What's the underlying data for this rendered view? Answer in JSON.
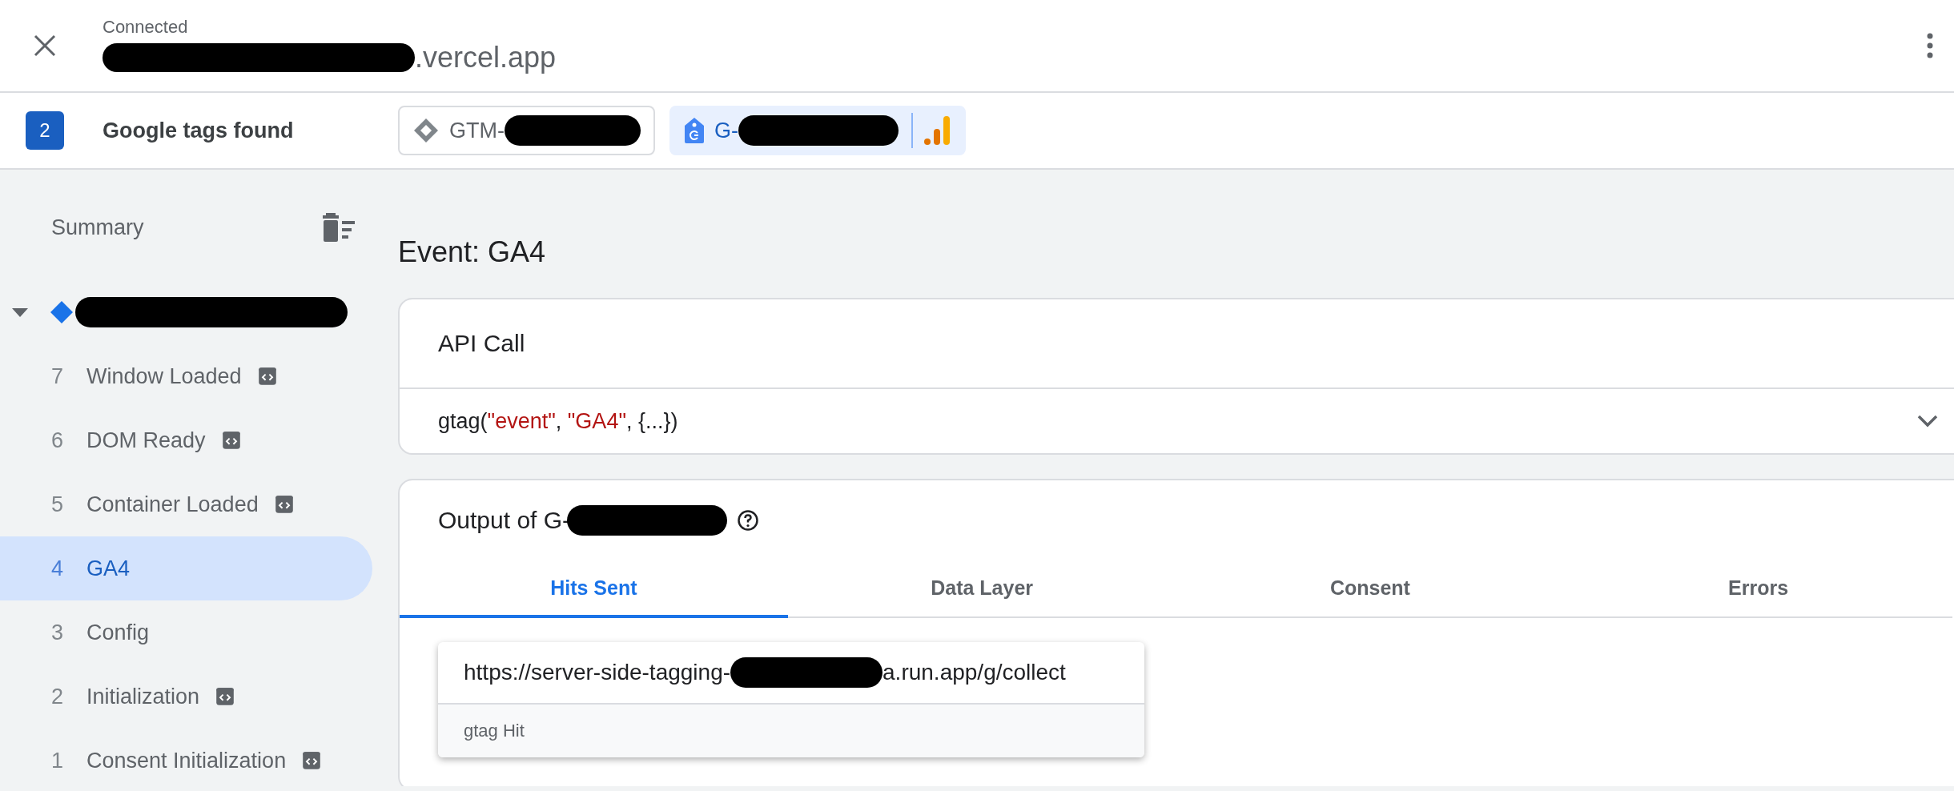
{
  "header": {
    "status": "Connected",
    "title": ".vercel.app"
  },
  "tags_bar": {
    "count": "2",
    "label": "Google tags found",
    "tags": [
      {
        "kind": "gtm",
        "id": "GTM-",
        "selected": false
      },
      {
        "kind": "ga",
        "id": "G-",
        "selected": true
      }
    ]
  },
  "sidebar": {
    "title": "Summary",
    "tree": {
      "expanded": true,
      "children": [
        {
          "number": "7",
          "label": "Window Loaded",
          "has_code_icon": true,
          "selected": false
        },
        {
          "number": "6",
          "label": "DOM Ready",
          "has_code_icon": true,
          "selected": false
        },
        {
          "number": "5",
          "label": "Container Loaded",
          "has_code_icon": true,
          "selected": false
        },
        {
          "number": "4",
          "label": "GA4",
          "has_code_icon": false,
          "selected": true
        },
        {
          "number": "3",
          "label": "Config",
          "has_code_icon": false,
          "selected": false
        },
        {
          "number": "2",
          "label": "Initialization",
          "has_code_icon": true,
          "selected": false
        },
        {
          "number": "1",
          "label": "Consent Initialization",
          "has_code_icon": true,
          "selected": false
        }
      ]
    }
  },
  "event_title": "Event: GA4",
  "api_call": {
    "title": "API Call",
    "expanded": false,
    "code": [
      {
        "kind": "plain",
        "text": "gtag("
      },
      {
        "kind": "string",
        "text": "\"event\""
      },
      {
        "kind": "plain",
        "text": ", "
      },
      {
        "kind": "string",
        "text": "\"GA4\""
      },
      {
        "kind": "plain",
        "text": ", {...})"
      }
    ]
  },
  "output": {
    "title": "Output of G-",
    "tabs": [
      {
        "label": "Hits Sent",
        "selected": true
      },
      {
        "label": "Data Layer",
        "selected": false
      },
      {
        "label": "Consent",
        "selected": false
      },
      {
        "label": "Errors",
        "selected": false
      }
    ],
    "hits": [
      {
        "url_start": "https://server-side-tagging-",
        "url_end": "a.run.app/g/collect",
        "type": "gtag Hit"
      }
    ]
  }
}
